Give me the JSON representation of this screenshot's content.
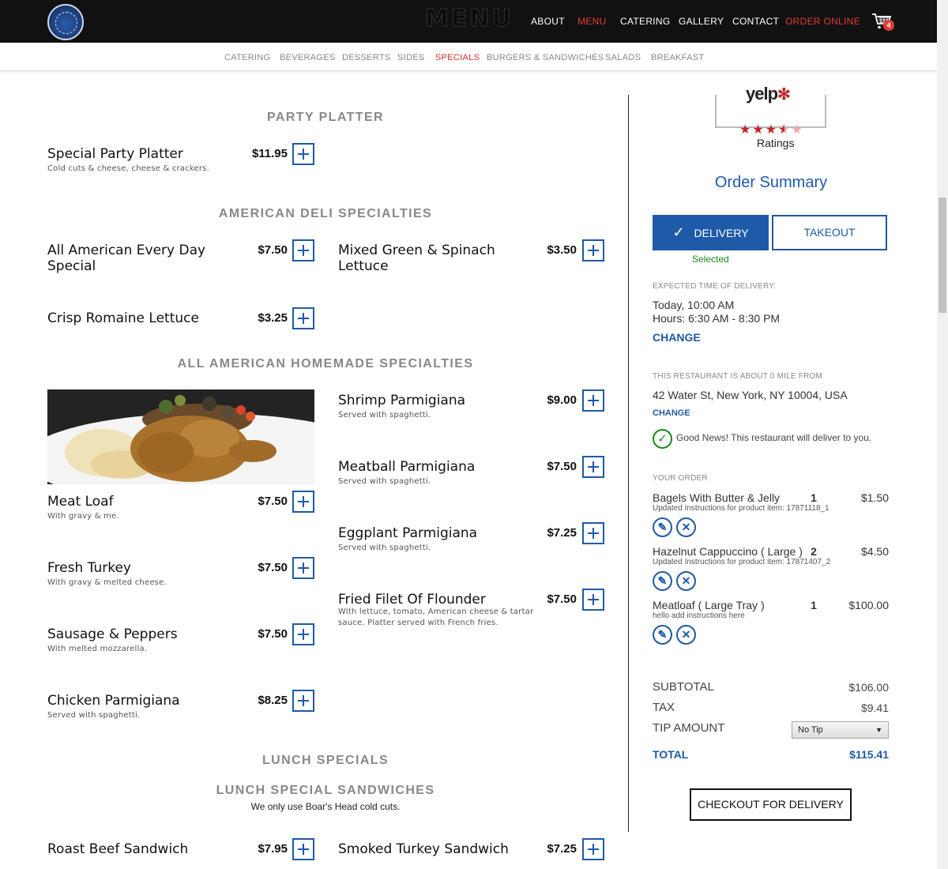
{
  "header": {
    "title": "MENU",
    "nav": [
      {
        "label": "ABOUT"
      },
      {
        "label": "MENU"
      },
      {
        "label": "CATERING"
      },
      {
        "label": "GALLERY"
      },
      {
        "label": "CONTACT"
      },
      {
        "label": "ORDER ONLINE"
      }
    ],
    "cart_count": "4",
    "accent_color": "#e53935"
  },
  "subnav": [
    {
      "label": "CATERING"
    },
    {
      "label": "BEVERAGES"
    },
    {
      "label": "DESSERTS"
    },
    {
      "label": "SIDES"
    },
    {
      "label": "SPECIALS"
    },
    {
      "label": "BURGERS & SANDWICHES"
    },
    {
      "label": "SALADS"
    },
    {
      "label": "BREAKFAST"
    }
  ],
  "sections": {
    "party": "PARTY PLATTER",
    "deli": "AMERICAN DELI SPECIALTIES",
    "homemade": "ALL AMERICAN HOMEMADE SPECIALTIES",
    "lunch": "LUNCH SPECIALS",
    "lunch_sandwiches": "LUNCH SPECIAL SANDWICHES",
    "lunch_sandwiches_note": "We only use Boar's Head cold cuts."
  },
  "items": {
    "party_platter": {
      "name": "Special Party Platter",
      "desc": "Cold cuts & cheese, cheese & crackers.",
      "price": "$11.95"
    },
    "all_american": {
      "name": "All American Every Day Special",
      "price": "$7.50"
    },
    "mixed_green": {
      "name": "Mixed Green & Spinach Lettuce",
      "price": "$3.50"
    },
    "crisp_romaine": {
      "name": "Crisp Romaine Lettuce",
      "price": "$3.25"
    },
    "meat_loaf": {
      "name": "Meat Loaf",
      "desc": "With gravy & me.",
      "price": "$7.50"
    },
    "fresh_turkey": {
      "name": "Fresh Turkey",
      "desc": "With gravy & melted cheese.",
      "price": "$7.50"
    },
    "sausage": {
      "name": "Sausage & Peppers",
      "desc": "With melted mozzarella.",
      "price": "$7.50"
    },
    "chicken_parm": {
      "name": "Chicken Parmigiana",
      "desc": "Served with spaghetti.",
      "price": "$8.25"
    },
    "shrimp_parm": {
      "name": "Shrimp Parmigiana",
      "desc": "Served with spaghetti.",
      "price": "$9.00"
    },
    "meatball_parm": {
      "name": "Meatball Parmigiana",
      "desc": "Served with spaghetti.",
      "price": "$7.50"
    },
    "eggplant_parm": {
      "name": "Eggplant Parmigiana",
      "desc": "Served with spaghetti.",
      "price": "$7.25"
    },
    "flounder": {
      "name": "Fried Filet Of Flounder",
      "desc": "With lettuce, tomato, American cheese & tartar sauce. Platter served with French fries.",
      "price": "$7.50"
    },
    "roast_beef": {
      "name": "Roast Beef Sandwich",
      "price": "$7.95"
    },
    "smoked_turkey": {
      "name": "Smoked Turkey Sandwich",
      "price": "$7.25"
    }
  },
  "sidebar": {
    "yelp_logo": "yelp",
    "yelp_rating": 3.5,
    "yelp_label": "Ratings",
    "order_summary": "Order Summary",
    "delivery_label": "DELIVERY",
    "takeout_label": "TAKEOUT",
    "selected_label": "Selected",
    "expected_label": "EXPECTED TIME OF DELIVERY:",
    "expected_time": "Today, 10:00 AM",
    "hours": "Hours: 6:30 AM - 8:30 PM",
    "change_time": "CHANGE",
    "distance_label": "THIS RESTAURANT IS ABOUT 0 MILE FROM",
    "address": "42 Water St, New York, NY 10004, USA",
    "change_address": "CHANGE",
    "good_news": "Good News! This restaurant will deliver to you.",
    "your_order_label": "YOUR ORDER",
    "order": [
      {
        "name": "Bagels With Butter & Jelly",
        "note": "Updated Instructions for product item: 17871118_1",
        "qty": "1",
        "price": "$1.50"
      },
      {
        "name": "Hazelnut Cappuccino ( Large )",
        "note": "Updated Instructions for product item: 17871407_2",
        "qty": "2",
        "price": "$4.50"
      },
      {
        "name": "Meatloaf ( Large Tray )",
        "note": "hello add instructions here",
        "qty": "1",
        "price": "$100.00"
      }
    ],
    "subtotal_label": "SUBTOTAL",
    "subtotal": "$106.00",
    "tax_label": "TAX",
    "tax": "$9.41",
    "tip_label": "TIP AMOUNT",
    "tip_value": "No Tip",
    "total_label": "TOTAL",
    "total": "$115.41",
    "checkout_label": "CHECKOUT FOR DELIVERY",
    "brand_color": "#1e5aa8"
  }
}
